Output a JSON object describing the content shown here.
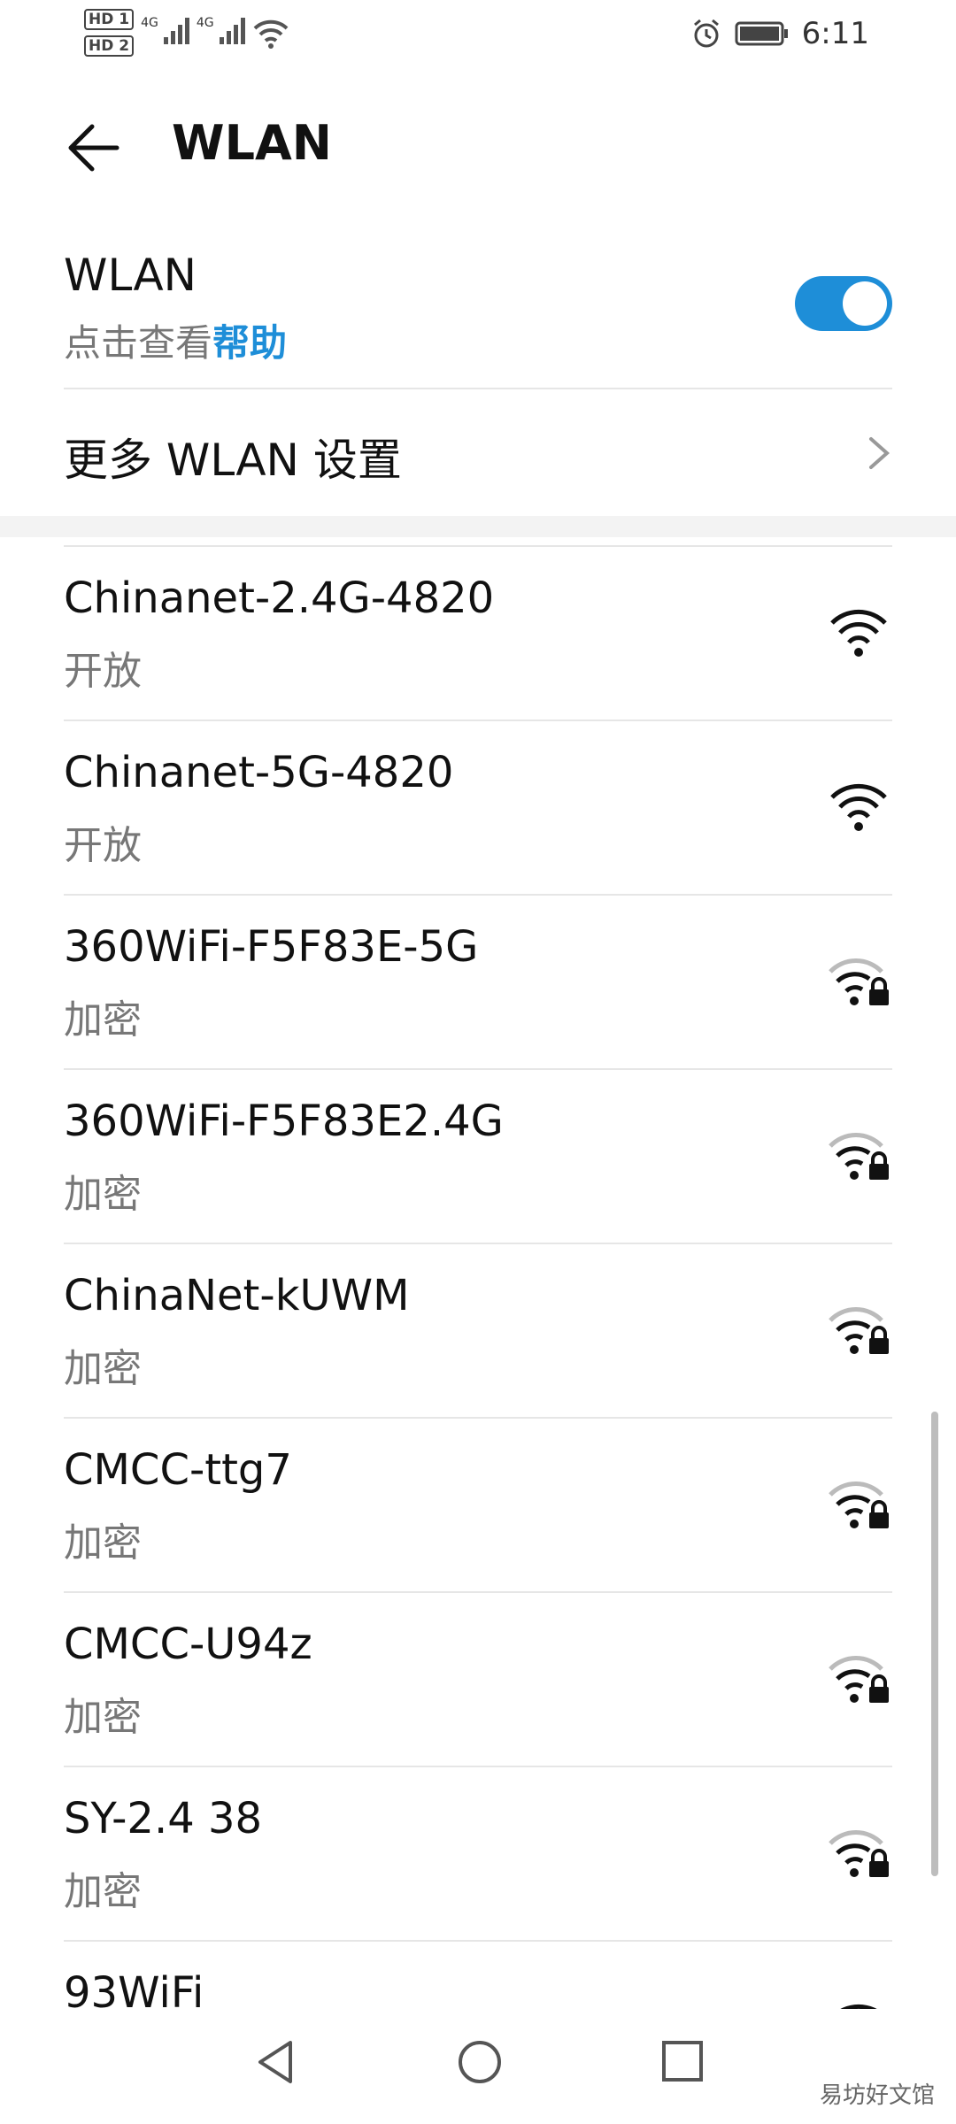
{
  "status_bar": {
    "sim_badges": [
      "HD 1",
      "HD 2"
    ],
    "network_labels": [
      "4G",
      "4G"
    ],
    "time": "6:11"
  },
  "header": {
    "title": "WLAN"
  },
  "wlan_toggle": {
    "label": "WLAN",
    "hint_prefix": "点击查看",
    "hint_link": "帮助",
    "enabled": true
  },
  "more_settings": {
    "label": "更多 WLAN 设置"
  },
  "networks": [
    {
      "name": "Chinanet-2.4G-4820",
      "security": "开放",
      "locked": false
    },
    {
      "name": "Chinanet-5G-4820",
      "security": "开放",
      "locked": false
    },
    {
      "name": "360WiFi-F5F83E-5G",
      "security": "加密",
      "locked": true
    },
    {
      "name": "360WiFi-F5F83E2.4G",
      "security": "加密",
      "locked": true
    },
    {
      "name": "ChinaNet-kUWM",
      "security": "加密",
      "locked": true
    },
    {
      "name": "CMCC-ttg7",
      "security": "加密",
      "locked": true
    },
    {
      "name": "CMCC-U94z",
      "security": "加密",
      "locked": true
    },
    {
      "name": "SY-2.4 38",
      "security": "加密",
      "locked": true
    },
    {
      "name": "93WiFi",
      "security": "",
      "locked": false
    }
  ],
  "watermark": "易坊好文馆",
  "colors": {
    "accent": "#1e8ed8"
  }
}
